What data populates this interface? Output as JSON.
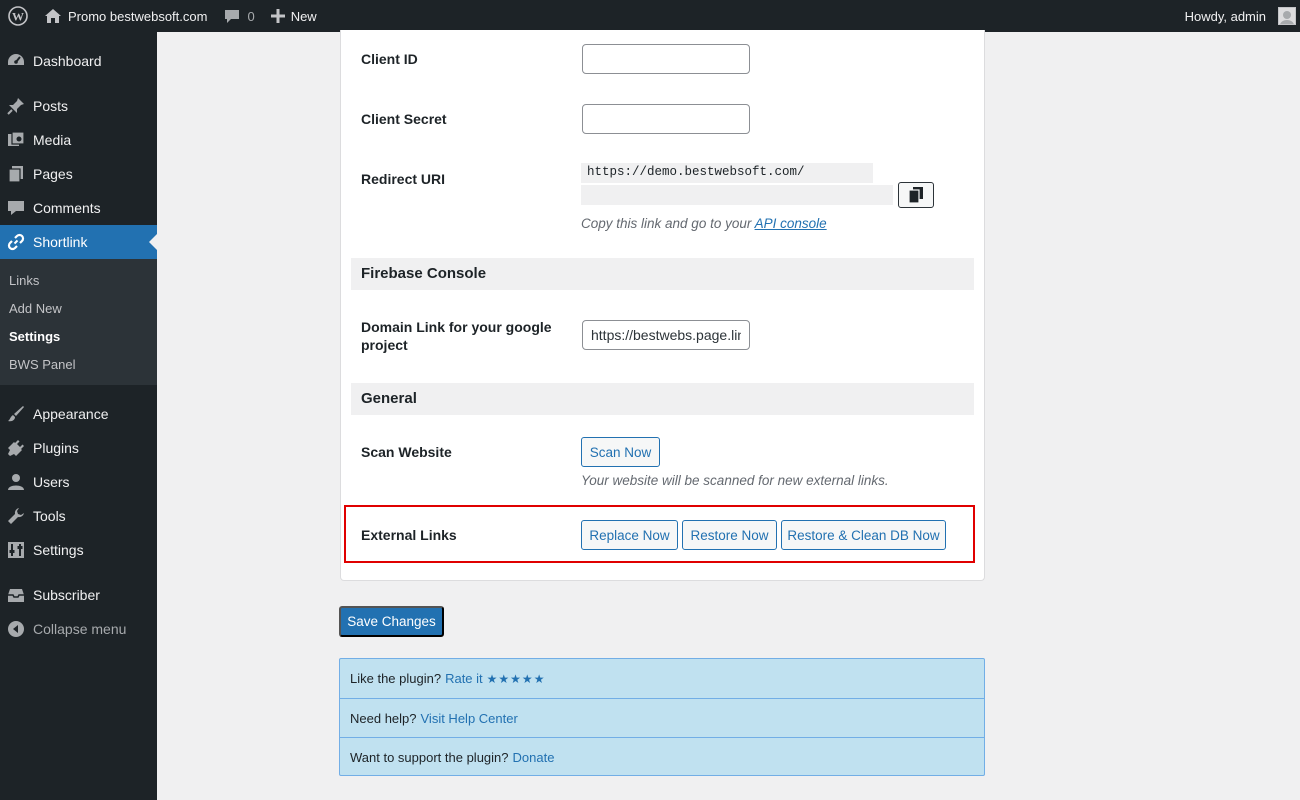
{
  "admin_bar": {
    "site_name": "Promo bestwebsoft.com",
    "comments_count": "0",
    "new_label": "New",
    "greeting": "Howdy, admin"
  },
  "sidebar": {
    "items": [
      {
        "label": "Dashboard",
        "icon": "dashboard-icon"
      },
      {
        "label": "Posts",
        "icon": "pin-icon"
      },
      {
        "label": "Media",
        "icon": "media-icon"
      },
      {
        "label": "Pages",
        "icon": "pages-icon"
      },
      {
        "label": "Comments",
        "icon": "comment-icon"
      },
      {
        "label": "Shortlink",
        "icon": "link-icon"
      },
      {
        "label": "Appearance",
        "icon": "brush-icon"
      },
      {
        "label": "Plugins",
        "icon": "plug-icon"
      },
      {
        "label": "Users",
        "icon": "user-icon"
      },
      {
        "label": "Tools",
        "icon": "wrench-icon"
      },
      {
        "label": "Settings",
        "icon": "settings-icon"
      },
      {
        "label": "Subscriber",
        "icon": "inbox-icon"
      },
      {
        "label": "Collapse menu",
        "icon": "collapse-icon"
      }
    ],
    "submenu": [
      "Links",
      "Add New",
      "Settings",
      "BWS Panel"
    ]
  },
  "form": {
    "client_id_label": "Client ID",
    "client_id_value": "",
    "client_secret_label": "Client Secret",
    "client_secret_value": "",
    "redirect_uri_label": "Redirect URI",
    "redirect_uri_line1": "https://demo.bestwebsoft.com/",
    "redirect_uri_desc": "Copy this link and go to your",
    "api_console_link": "API console",
    "firebase_heading": "Firebase Console",
    "domain_link_label": "Domain Link for your google project",
    "domain_link_value": "https://bestwebs.page.link",
    "general_heading": "General",
    "scan_label": "Scan Website",
    "scan_button": "Scan Now",
    "scan_desc": "Your website will be scanned for new external links.",
    "external_label": "External Links",
    "replace_button": "Replace Now",
    "restore_button": "Restore Now",
    "restore_clean_button": "Restore & Clean DB Now",
    "save_button": "Save Changes"
  },
  "info": {
    "rate_text": "Like the plugin?",
    "rate_link": "Rate it",
    "rate_stars": "★★★★★",
    "help_text": "Need help?",
    "help_link": "Visit Help Center",
    "support_text": "Want to support the plugin?",
    "support_link": "Donate"
  },
  "colors": {
    "admin_bg": "#1d2327",
    "accent": "#2271b1",
    "highlight": "#e00000",
    "info_bg": "#c0e1f0"
  }
}
